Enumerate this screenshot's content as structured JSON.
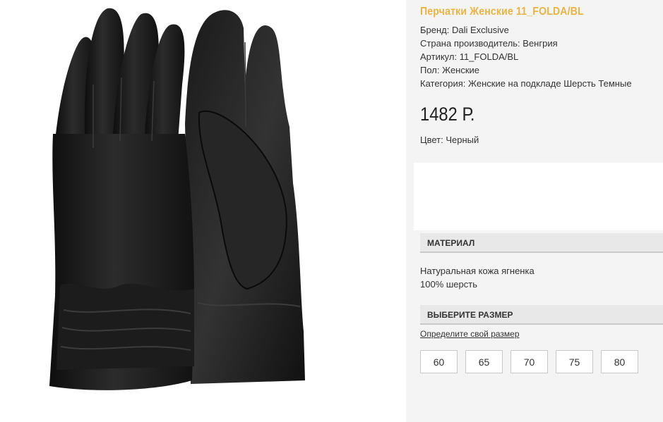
{
  "product": {
    "title": "Перчатки Женские 11_FOLDA/BL",
    "brand": "Бренд: Dali Exclusive",
    "country": "Страна производитель: Венгрия",
    "sku": "Артикул: 11_FOLDA/BL",
    "gender": "Пол: Женские",
    "category": "Категория: Женские на подкладе Шерсть Темные",
    "price": "1482 Р.",
    "color": "Цвет: Черный"
  },
  "material": {
    "header": "МАТЕРИАЛ",
    "lines": [
      "Натуральная кожа ягненка",
      "100% шерсть"
    ]
  },
  "size": {
    "header": "ВЫБЕРИТЕ РАЗМЕР",
    "link": "Определите свой размер",
    "options": [
      "60",
      "65",
      "70",
      "75",
      "80"
    ]
  },
  "colors": {
    "title_accent": "#e8b445",
    "panel_bg": "#f4f4f4",
    "header_bg": "#e8e8e8"
  }
}
